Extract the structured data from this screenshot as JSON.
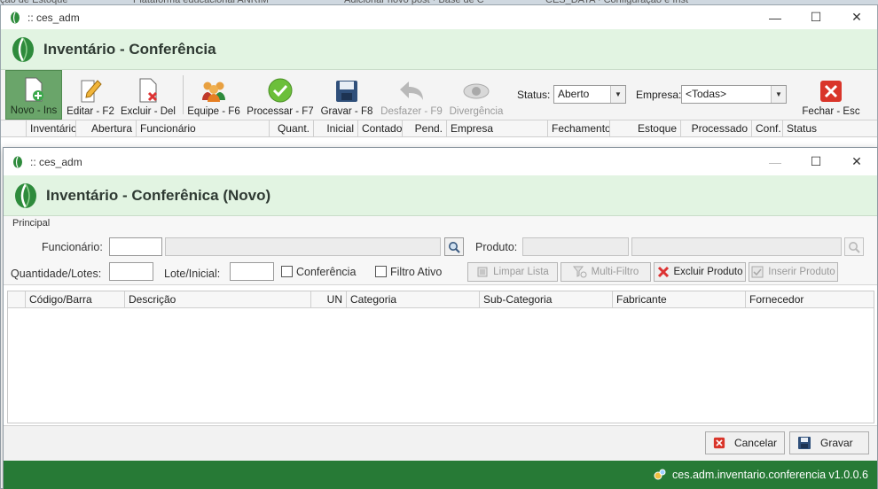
{
  "background_tabs": [
    "ção de Estoque",
    "Plataforma educacional ANRIM",
    "Adicionar novo post · Base de C",
    "CES_DATA · Configuração e Inst"
  ],
  "main_window": {
    "title": ":: ces_adm",
    "banner_title": "Inventário - Conferência",
    "toolbar": {
      "novo": "Novo - Ins",
      "editar": "Editar - F2",
      "excluir": "Excluir - Del",
      "equipe": "Equipe - F6",
      "processar": "Processar - F7",
      "gravar": "Gravar - F8",
      "desfazer": "Desfazer - F9",
      "divergencia": "Divergência",
      "status_label": "Status:",
      "status_value": "Aberto",
      "empresa_label": "Empresa:",
      "empresa_value": "<Todas>",
      "fechar": "Fechar - Esc"
    },
    "grid_columns": [
      "Inventário",
      "Abertura",
      "Funcionário",
      "Quant.",
      "Inicial",
      "Contado",
      "Pend.",
      "Empresa",
      "Fechamento",
      "Estoque",
      "Processado",
      "Conf.",
      "Status"
    ]
  },
  "modal": {
    "title": ":: ces_adm",
    "banner_title": "Inventário - Conferênica (Novo)",
    "section_label": "Principal",
    "labels": {
      "funcionario": "Funcionário:",
      "produto": "Produto:",
      "quantidade_lotes": "Quantidade/Lotes:",
      "lote_inicial": "Lote/Inicial:",
      "conferencia": "Conferência",
      "filtro_ativo": "Filtro Ativo"
    },
    "actions": {
      "limpar_lista": "Limpar Lista",
      "multi_filtro": "Multi-Filtro",
      "excluir_produto": "Excluir Produto",
      "inserir_produto": "Inserir Produto"
    },
    "grid_columns": [
      "Código/Barra",
      "Descrição",
      "UN",
      "Categoria",
      "Sub-Categoria",
      "Fabricante",
      "Fornecedor"
    ],
    "footer": {
      "cancelar": "Cancelar",
      "gravar": "Gravar"
    },
    "statusbar": "ces.adm.inventario.conferencia v1.0.0.6"
  },
  "colors": {
    "banner": "#e2f4e2",
    "statusbar": "#277a36",
    "active_button": "#6aa56a"
  }
}
